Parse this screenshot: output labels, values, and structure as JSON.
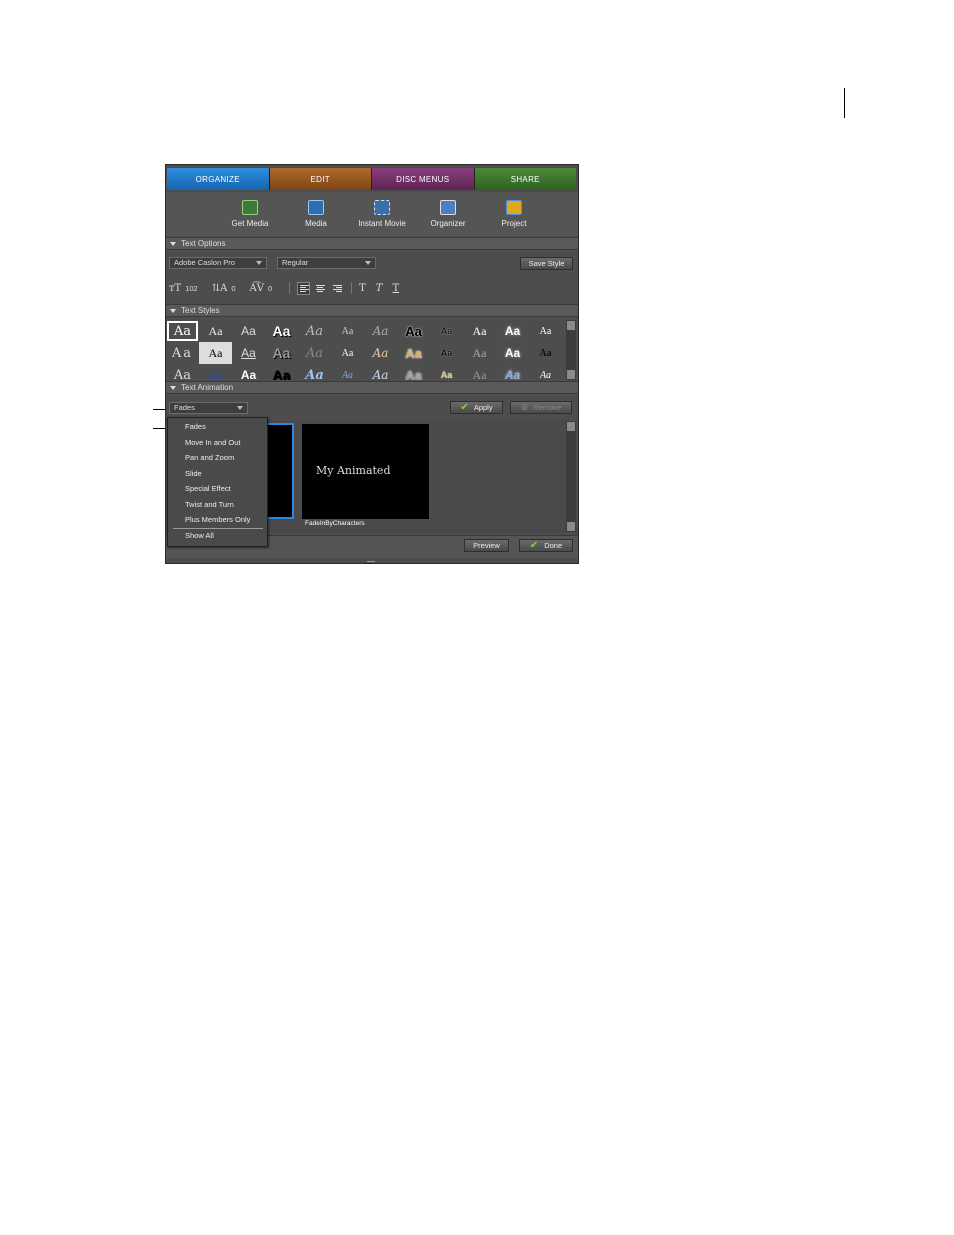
{
  "tabs": [
    {
      "label": "ORGANIZE"
    },
    {
      "label": "EDIT"
    },
    {
      "label": "DISC MENUS"
    },
    {
      "label": "SHARE"
    }
  ],
  "toolbar": {
    "items": [
      {
        "label": "Get Media",
        "icon": "get-media-icon"
      },
      {
        "label": "Media",
        "icon": "media-icon"
      },
      {
        "label": "Instant Movie",
        "icon": "instant-movie-icon"
      },
      {
        "label": "Organizer",
        "icon": "organizer-icon"
      },
      {
        "label": "Project",
        "icon": "project-icon"
      }
    ]
  },
  "text_options": {
    "header": "Text Options",
    "font": "Adobe Caslon Pro",
    "style": "Regular",
    "save_style": "Save Style",
    "font_size": "102",
    "leading": "0",
    "kerning": "0"
  },
  "text_styles": {
    "header": "Text Styles",
    "swatch_glyph": "Aa"
  },
  "text_animation": {
    "header": "Text Animation",
    "selected": "Fades",
    "apply": "Apply",
    "remove": "Remove",
    "menu_items": [
      "Fades",
      "Move In and Out",
      "Pan and Zoom",
      "Slide",
      "Special Effect",
      "Twist and Turn",
      "Plus Members Only"
    ],
    "menu_show_all": "Show All",
    "thumbnail_text": "My Animated",
    "thumbnail_caption": "FadeInByCharacters"
  },
  "footer": {
    "preview": "Preview",
    "done": "Done"
  },
  "colors": {
    "panel_bg": "#4d4d4d",
    "organize_tab": "#1f77c9",
    "edit_tab": "#9a5a22",
    "disc_menus_tab": "#74316a",
    "share_tab": "#3f7a2e",
    "check": "#7fd43a"
  }
}
